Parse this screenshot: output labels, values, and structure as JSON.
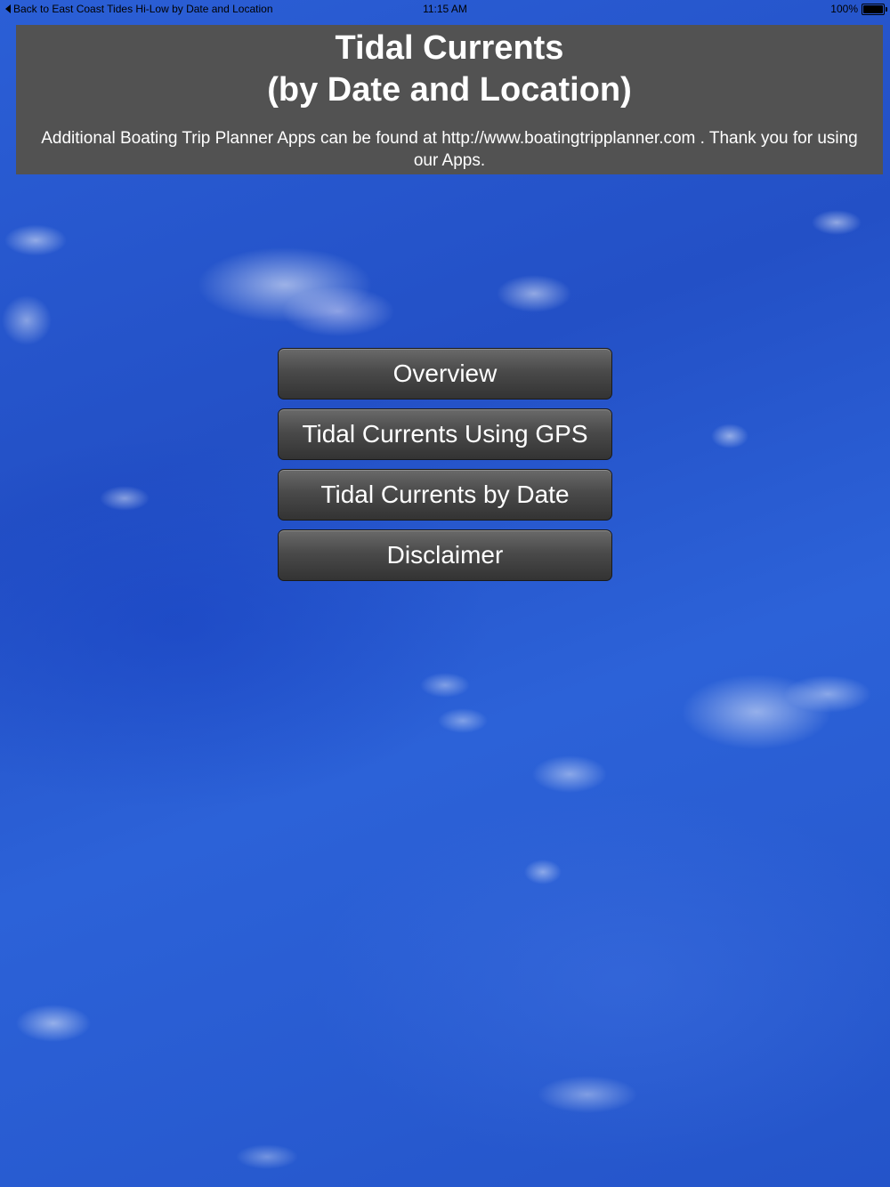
{
  "status_bar": {
    "back_label": "Back to East Coast Tides Hi-Low by Date and Location",
    "time": "11:15 AM",
    "battery_percent": "100%",
    "battery_level": 1.0
  },
  "header": {
    "title": "Tidal Currents",
    "subtitle": "(by Date and Location)",
    "note": "Additional Boating Trip Planner Apps can be found at http://www.boatingtripplanner.com . Thank you for using our Apps."
  },
  "menu": {
    "items": [
      {
        "label": "Overview"
      },
      {
        "label": "Tidal Currents Using GPS"
      },
      {
        "label": "Tidal Currents by Date"
      },
      {
        "label": "Disclaimer"
      }
    ]
  },
  "colors": {
    "panel": "#525252",
    "ocean": "#2a5bd0",
    "button": "#4a4a4a"
  }
}
